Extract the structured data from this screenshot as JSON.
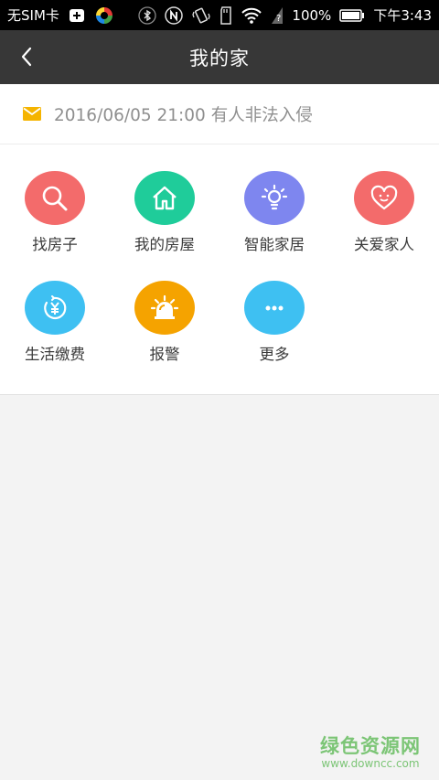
{
  "status_bar": {
    "carrier": "无SIM卡",
    "battery": "100%",
    "time": "下午3:43"
  },
  "nav": {
    "title": "我的家"
  },
  "notice": {
    "text": "2016/06/05 21:00 有人非法入侵",
    "icon": "mail-icon",
    "icon_color": "#f5b400"
  },
  "grid": {
    "items": [
      {
        "label": "找房子",
        "icon": "search-icon",
        "color": "#f36b6b"
      },
      {
        "label": "我的房屋",
        "icon": "house-icon",
        "color": "#1fcc9a"
      },
      {
        "label": "智能家居",
        "icon": "lightbulb-icon",
        "color": "#7e86ef"
      },
      {
        "label": "关爱家人",
        "icon": "heart-icon",
        "color": "#f36b6b"
      },
      {
        "label": "生活缴费",
        "icon": "yen-icon",
        "color": "#3ec0f2"
      },
      {
        "label": "报警",
        "icon": "alarm-icon",
        "color": "#f5a300"
      },
      {
        "label": "更多",
        "icon": "more-icon",
        "color": "#3ec0f2"
      }
    ]
  },
  "watermark": {
    "title": "绿色资源网",
    "url": "www.downcc.com"
  }
}
